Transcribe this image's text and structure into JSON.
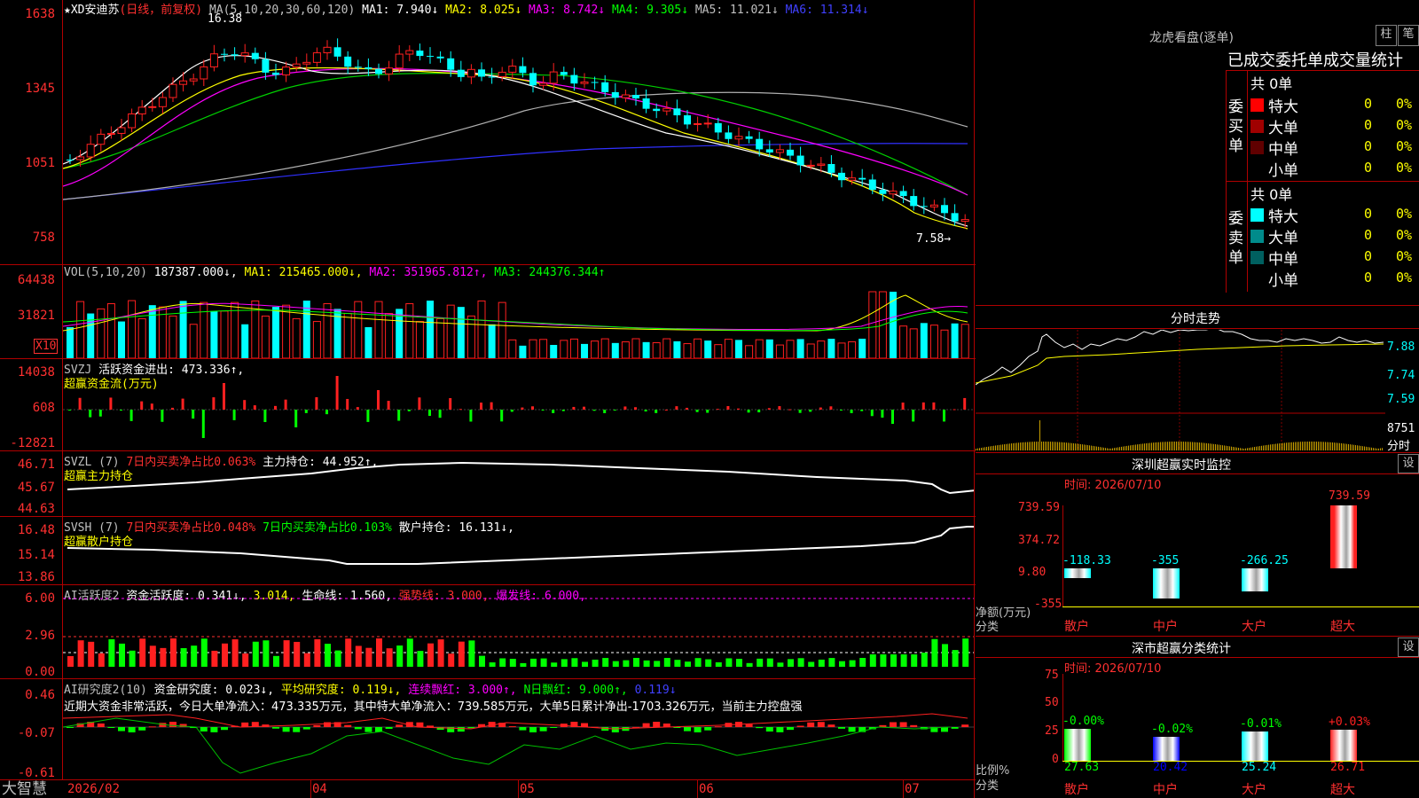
{
  "main": {
    "title_symbol": "★XD安迪苏",
    "title_mode": "(日线，前复权)",
    "ma_label": "MA(5,10,20,30,60,120)",
    "ma1": "MA1: 7.940↓",
    "ma2": "MA2: 8.025↓",
    "ma3": "MA3: 8.742↓",
    "ma4": "MA4: 9.305↓",
    "ma5": "MA5: 11.021↓",
    "ma6": "MA6: 11.314↓",
    "high_mark": "16.38",
    "low_mark": "7.58→",
    "y_ticks": [
      "1638",
      "1345",
      "1051",
      "758"
    ]
  },
  "vol": {
    "label": "VOL(5,10,20)",
    "value": "187387.000↓,",
    "ma1": "MA1: 215465.000↓,",
    "ma2": "MA2: 351965.812↑,",
    "ma3": "MA3: 244376.344↑",
    "y_ticks": [
      "64438",
      "31821"
    ],
    "unit": "X10"
  },
  "svzj": {
    "label": "SVZJ",
    "text": "活跃资金进出: 473.336↑,",
    "subtitle": "超赢资金流(万元)",
    "y_ticks": [
      "14038",
      "608",
      "-12821"
    ]
  },
  "svzl": {
    "label": "SVZL (7)",
    "red_text": "7日内买卖净占比0.063%",
    "white_text": "主力持仓: 44.952↑,",
    "subtitle": "超赢主力持仓",
    "y_ticks": [
      "46.71",
      "45.67",
      "44.63"
    ]
  },
  "svsh": {
    "label": "SVSH (7)",
    "red_text": "7日内买卖净占比0.048%",
    "green_text": "7日内买卖净占比0.103%",
    "white_text": "散户持仓: 16.131↓,",
    "subtitle": "超赢散户持仓",
    "y_ticks": [
      "16.48",
      "15.14",
      "13.86"
    ]
  },
  "ai1": {
    "label": "AI活跃度2",
    "t1": "资金活跃度: 0.341↓,",
    "t2": "3.014,",
    "t3": "生命线: 1.560,",
    "t4": "强势线: 3.000,",
    "t5": "爆发线: 6.000,",
    "y_ticks": [
      "6.00",
      "2.96",
      "0.00"
    ]
  },
  "ai2": {
    "label": "AI研究度2(10)",
    "t1": "资金研究度: 0.023↓,",
    "t2": "平均研究度: 0.119↓,",
    "t3": "连续飘红: 3.000↑,",
    "t4": "N日飘红: 9.000↑,",
    "t5": "0.119↓",
    "comment": "近期大资金非常活跃，今日大单净流入：473.335万元，其中特大单净流入：739.585万元，大单5日累计净出-1703.326万元，当前主力控盘强",
    "y_ticks": [
      "0.46",
      "-0.07",
      "-0.61"
    ]
  },
  "xaxis": {
    "logo": "大智慧",
    "labels": [
      "2026/02",
      "04",
      "05",
      "06",
      "07"
    ]
  },
  "right": {
    "lhb_title": "龙虎看盘(逐单)",
    "btn1": "柱",
    "btn2": "笔",
    "stats_title": "已成交委托单成交量统计",
    "buy_label": "委买单",
    "sell_label": "委卖单",
    "buy_total": "共 0单",
    "sell_total": "共 0单",
    "buy_rows": [
      {
        "name": "特大",
        "val": "0",
        "pct": "0%",
        "color": "#ff0000"
      },
      {
        "name": "大单",
        "val": "0",
        "pct": "0%",
        "color": "#a00000"
      },
      {
        "name": "中单",
        "val": "0",
        "pct": "0%",
        "color": "#600000"
      },
      {
        "name": "小单",
        "val": "0",
        "pct": "0%",
        "color": ""
      }
    ],
    "sell_rows": [
      {
        "name": "特大",
        "val": "0",
        "pct": "0%",
        "color": "#00ffff"
      },
      {
        "name": "大单",
        "val": "0",
        "pct": "0%",
        "color": "#008b8b"
      },
      {
        "name": "中单",
        "val": "0",
        "pct": "0%",
        "color": "#006060"
      },
      {
        "name": "小单",
        "val": "0",
        "pct": "0%",
        "color": ""
      }
    ],
    "intraday_title": "分时走势",
    "intraday_ticks": [
      "7.88",
      "7.74",
      "7.59"
    ],
    "intraday_vol": "8751",
    "intraday_vol_unit": "分时",
    "sz_title": "深圳超赢实时监控",
    "sz_btn": "设",
    "sz_time": "时间: 2026/07/10",
    "sz_yticks": [
      "739.59",
      "374.72",
      "9.80",
      "-355"
    ],
    "sz_ylabel": "净额(万元)",
    "sz_xlabel": "分类",
    "sz_bars": [
      {
        "cat": "散户",
        "val": "-118.33",
        "color": "#00c0ff"
      },
      {
        "cat": "中户",
        "val": "-355",
        "color": "#00ffff"
      },
      {
        "cat": "大户",
        "val": "-266.25",
        "color": "#00ffff"
      },
      {
        "cat": "超大",
        "val": "739.59",
        "color": "#ff2020"
      }
    ],
    "cls_title": "深市超赢分类统计",
    "cls_btn": "设",
    "cls_time": "时间: 2026/07/10",
    "cls_yticks": [
      "75",
      "50",
      "25",
      "0"
    ],
    "cls_ylabel": "比例%",
    "cls_xlabel": "分类",
    "cls_bars": [
      {
        "cat": "散户",
        "top": "-0.00%",
        "bottom": "27.63",
        "top_color": "#00ff00",
        "bottom_color": "#00ff00"
      },
      {
        "cat": "中户",
        "top": "-0.02%",
        "bottom": "20.42",
        "top_color": "#00ff00",
        "bottom_color": "#0000ff"
      },
      {
        "cat": "大户",
        "top": "-0.01%",
        "bottom": "25.24",
        "top_color": "#00ff00",
        "bottom_color": "#00ffff"
      },
      {
        "cat": "超大",
        "top": "+0.03%",
        "bottom": "26.71",
        "top_color": "#ff2020",
        "bottom_color": "#ff2020"
      }
    ]
  }
}
